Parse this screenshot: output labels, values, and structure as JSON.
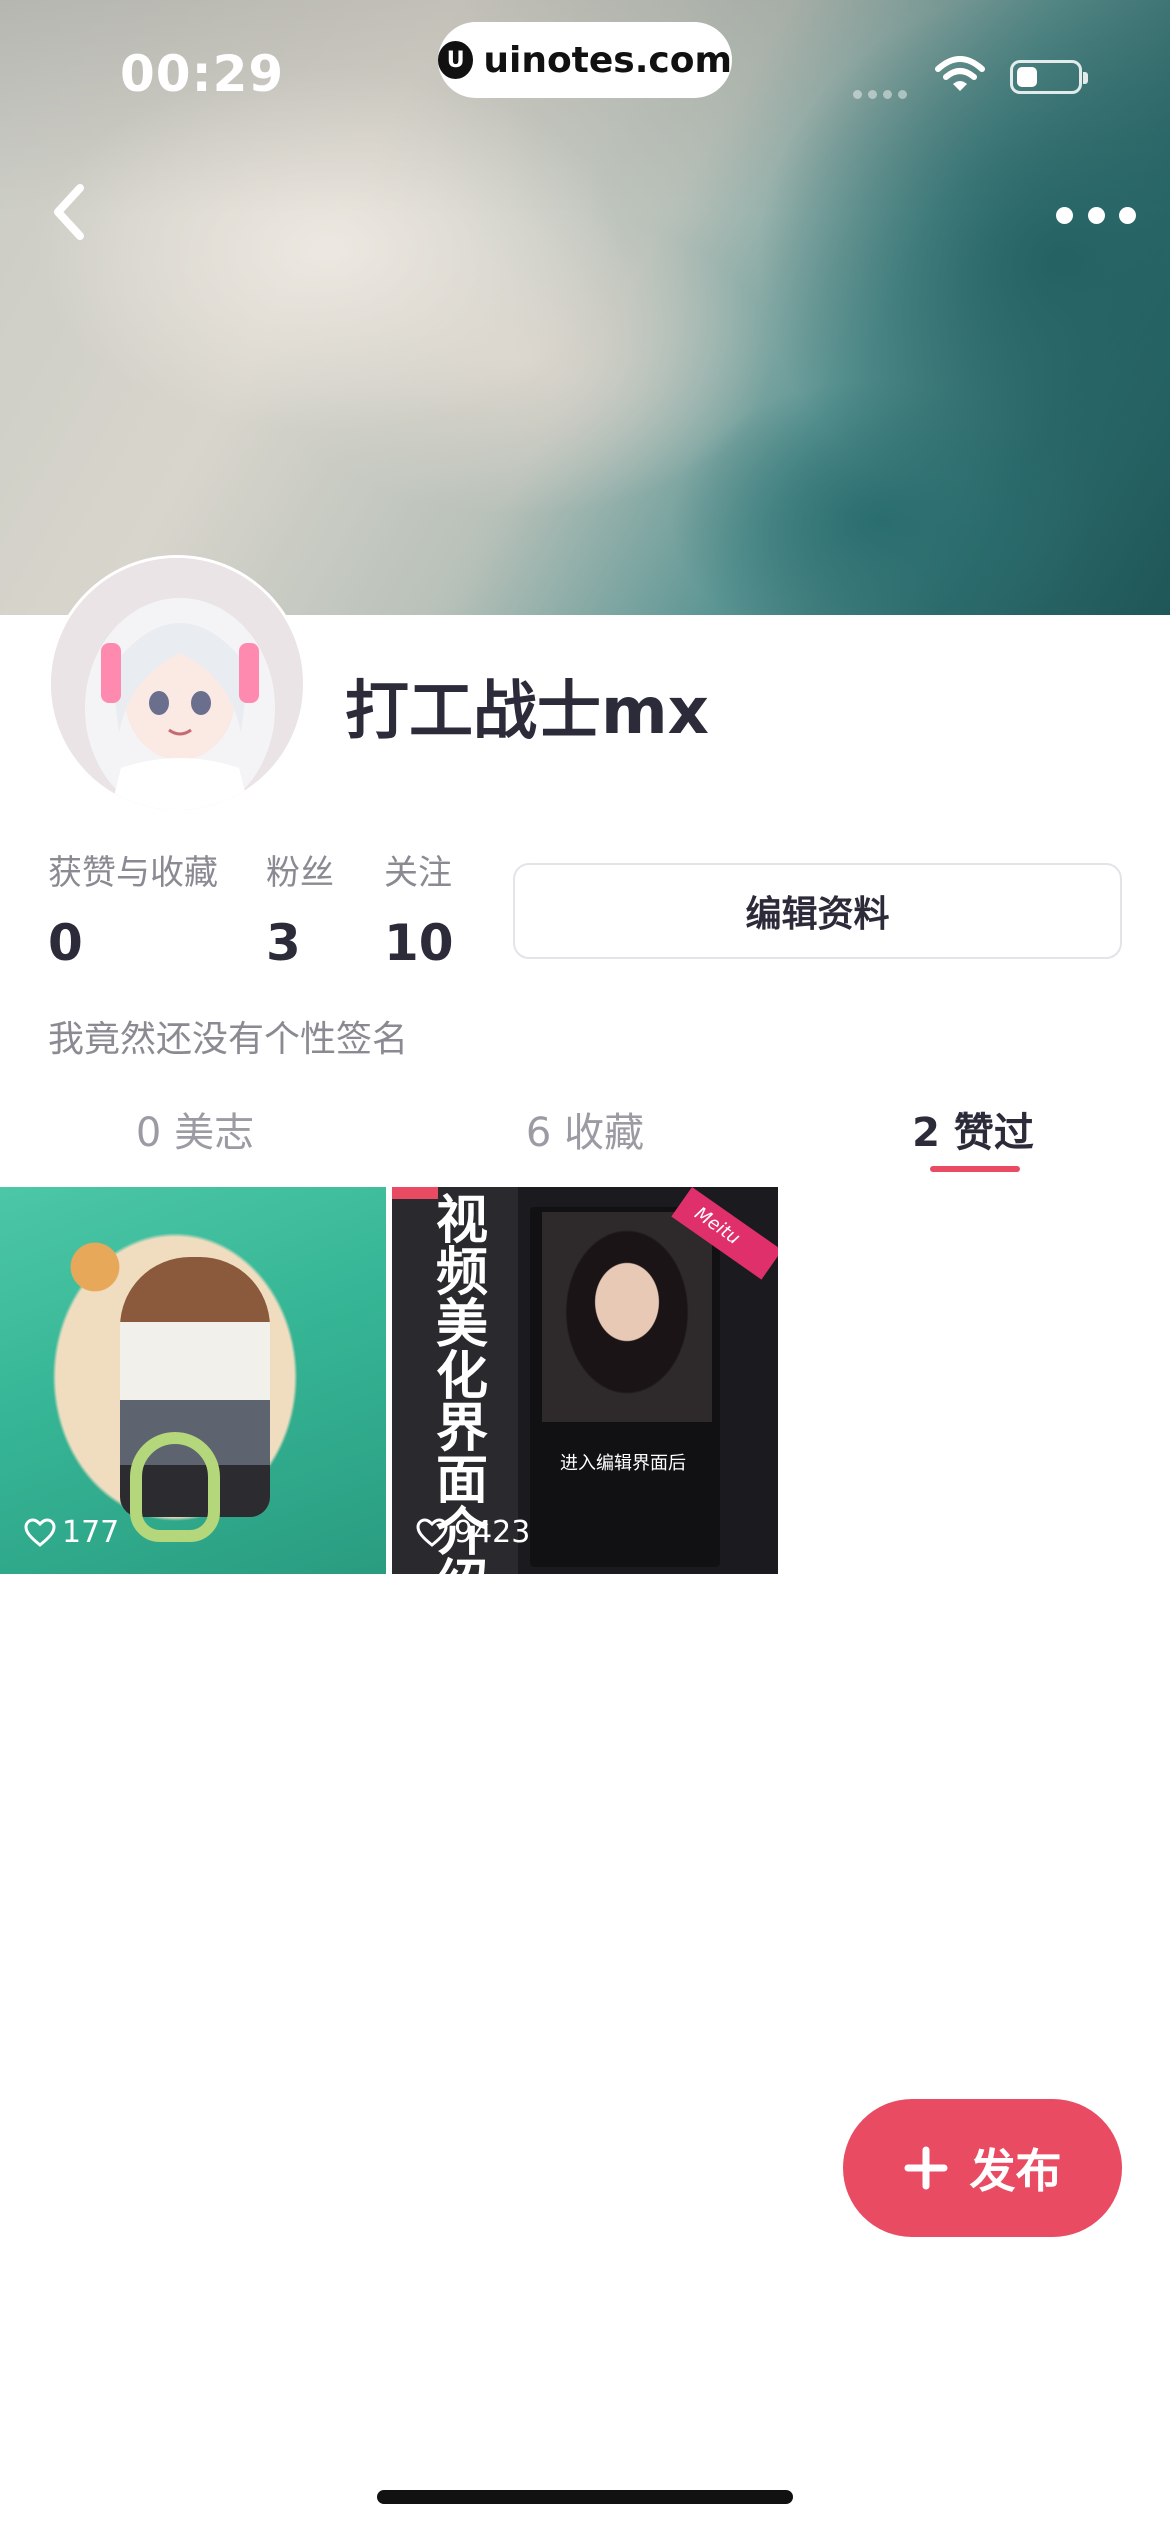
{
  "status_bar": {
    "time": "00:29",
    "url": "uinotes.com",
    "url_logo": "U",
    "battery_level": 0.35
  },
  "profile": {
    "username": "打工战士mx",
    "bio": "我竟然还没有个性签名",
    "edit_button": "编辑资料",
    "stats": [
      {
        "label": "获赞与收藏",
        "value": "0"
      },
      {
        "label": "粉丝",
        "value": "3"
      },
      {
        "label": "关注",
        "value": "10"
      }
    ]
  },
  "tabs": [
    {
      "label": "0 美志",
      "active": false
    },
    {
      "label": "6 收藏",
      "active": false
    },
    {
      "label": "2 赞过",
      "active": true
    }
  ],
  "posts": [
    {
      "likes": "177"
    },
    {
      "likes": "9423",
      "cover_text": "视频美化界面介绍",
      "caption": "进入编辑界面后",
      "tag": "Meitu"
    }
  ],
  "publish_button": {
    "label": "发布",
    "icon": "plus-icon"
  },
  "colors": {
    "accent": "#e94b63",
    "text_primary": "#2b2b3a",
    "text_secondary": "#8a8a92"
  },
  "icons": [
    "back-icon",
    "more-icon",
    "wifi-icon",
    "battery-icon",
    "heart-icon",
    "plus-icon"
  ]
}
